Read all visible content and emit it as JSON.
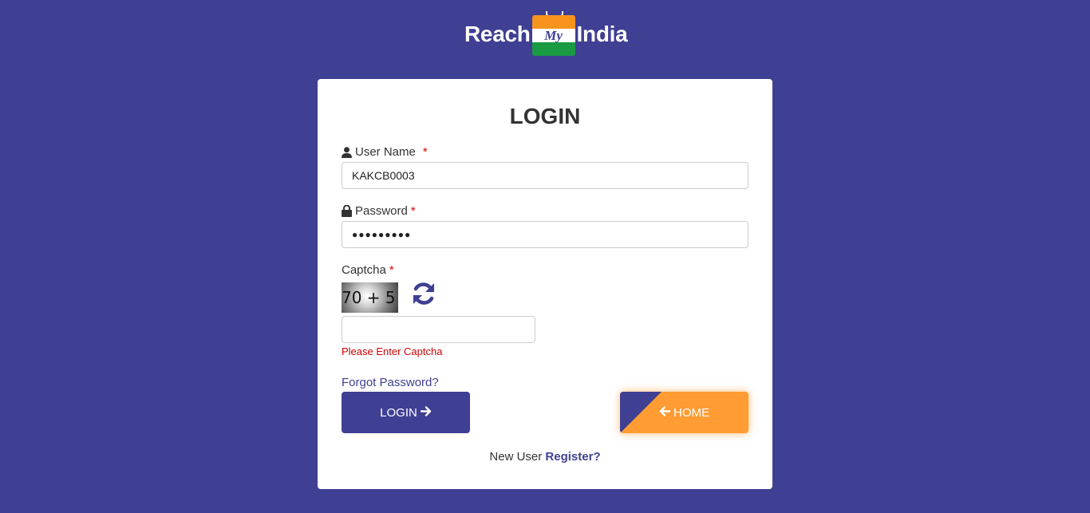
{
  "logo": {
    "left_text": "Reach",
    "bag_text": "My",
    "right_text": "India"
  },
  "form": {
    "title": "LOGIN",
    "username": {
      "label": "User Name",
      "required_mark": "*",
      "value": "KAKCB0003"
    },
    "password": {
      "label": "Password",
      "required_mark": "*",
      "value": "●●●●●●●●●"
    },
    "captcha": {
      "label": "Captcha",
      "required_mark": "*",
      "image_text": "70 + 5",
      "value": "",
      "error": "Please Enter Captcha"
    },
    "forgot_password": "Forgot Password?",
    "login_button": "LOGIN",
    "home_button": "HOME",
    "new_user_text": "New User",
    "register_link": "Register?"
  },
  "colors": {
    "brand": "#3f3f94",
    "accent": "#ff9c33",
    "error": "#cc0000"
  }
}
